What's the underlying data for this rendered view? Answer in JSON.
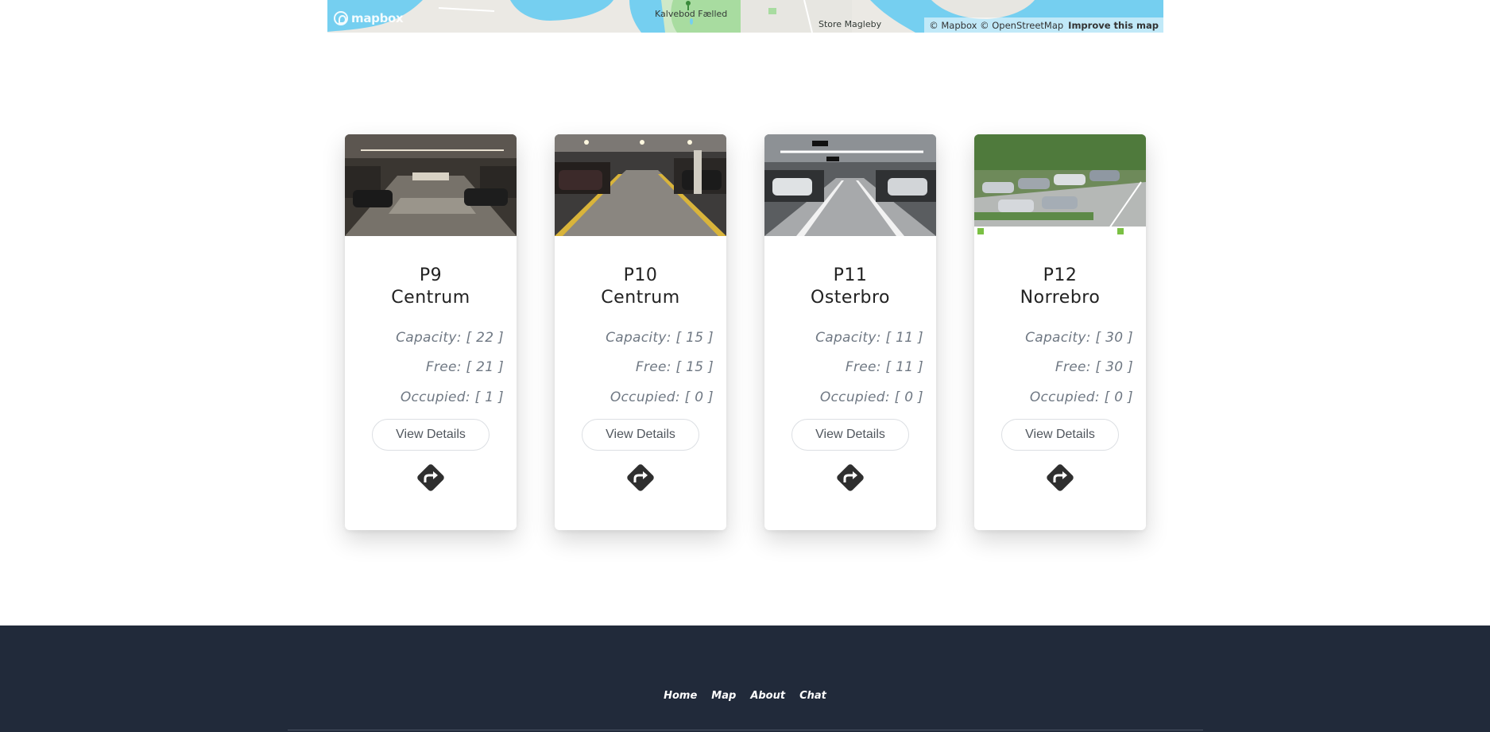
{
  "map": {
    "logo_text": "mapbox",
    "places": [
      "Kalvebod Fælled",
      "Store Magleby"
    ],
    "attribution": "© Mapbox © OpenStreetMap",
    "improve_link": "Improve this map",
    "colors": {
      "water": "#75cff0",
      "park": "#a8dca0",
      "land": "#ebe9e4"
    }
  },
  "cards": [
    {
      "name_line1": "P9",
      "name_line2": "Centrum",
      "capacity": "Capacity: [ 22 ]",
      "free": "Free: [ 21 ]",
      "occupied": "Occupied: [ 1 ]",
      "details_label": "View Details",
      "icon": "directions-icon"
    },
    {
      "name_line1": "P10",
      "name_line2": "Centrum",
      "capacity": "Capacity: [ 15 ]",
      "free": "Free: [ 15 ]",
      "occupied": "Occupied: [ 0 ]",
      "details_label": "View Details",
      "icon": "directions-icon"
    },
    {
      "name_line1": "P11",
      "name_line2": "Osterbro",
      "capacity": "Capacity: [ 11 ]",
      "free": "Free: [ 11 ]",
      "occupied": "Occupied: [ 0 ]",
      "details_label": "View Details",
      "icon": "directions-icon"
    },
    {
      "name_line1": "P12",
      "name_line2": "Norrebro",
      "capacity": "Capacity: [ 30 ]",
      "free": "Free: [ 30 ]",
      "occupied": "Occupied: [ 0 ]",
      "details_label": "View Details",
      "icon": "directions-icon"
    }
  ],
  "footer": {
    "nav": [
      "Home",
      "Map",
      "About",
      "Chat"
    ],
    "background": "#212a3a"
  }
}
